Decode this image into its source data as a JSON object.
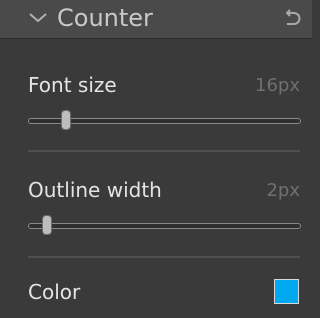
{
  "header": {
    "title": "Counter",
    "collapse_icon": "chevron-down-icon",
    "reset_icon": "undo-icon"
  },
  "settings": {
    "font_size": {
      "label": "Font size",
      "value": "16px",
      "slider_fraction": 0.14
    },
    "outline_width": {
      "label": "Outline width",
      "value": "2px",
      "slider_fraction": 0.07
    },
    "color": {
      "label": "Color",
      "swatch_color": "#00a8f0"
    }
  }
}
